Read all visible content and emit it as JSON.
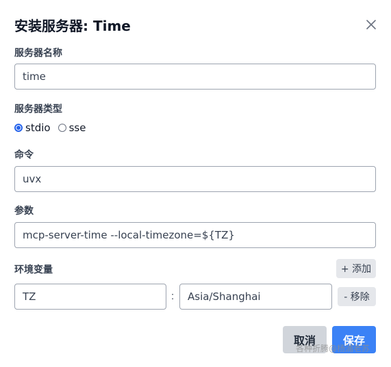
{
  "dialog": {
    "title": "安装服务器: Time",
    "close_icon": "close-icon"
  },
  "server_name": {
    "label": "服务器名称",
    "value": "time"
  },
  "server_type": {
    "label": "服务器类型",
    "options": [
      "stdio",
      "sse"
    ],
    "selected": "stdio"
  },
  "command": {
    "label": "命令",
    "value": "uvx"
  },
  "args": {
    "label": "参数",
    "value": "mcp-server-time --local-timezone=${TZ}"
  },
  "env": {
    "label": "环境变量",
    "add_label": "+ 添加",
    "remove_label": "- 移除",
    "separator": ":",
    "rows": [
      {
        "key": "TZ",
        "value": "Asia/Shanghai"
      }
    ]
  },
  "actions": {
    "cancel_label": "取消",
    "save_label": "保存",
    "accent": "#3b82f6"
  },
  "watermark": "各种折腾@杨浦老苏"
}
